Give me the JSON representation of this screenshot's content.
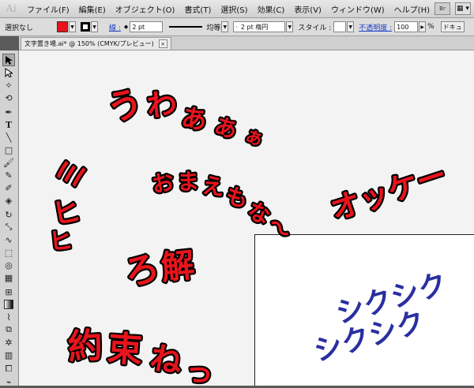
{
  "app": {
    "logo": "Ai"
  },
  "menu": [
    "ファイル(F)",
    "編集(E)",
    "オブジェクト(O)",
    "書式(T)",
    "選択(S)",
    "効果(C)",
    "表示(V)",
    "ウィンドウ(W)",
    "ヘルプ(H)"
  ],
  "menu_right": {
    "bridge": "Br",
    "arrange": "▦ ▾"
  },
  "control": {
    "selection": "選択なし",
    "fill_color": "#e8141c",
    "stroke_color": "#000000",
    "stroke_label": "線 :",
    "stroke_weight": "2 pt",
    "stroke_profile": "均等",
    "brush": "2 pt 楕円",
    "style_label": "スタイル :",
    "opacity_label": "不透明度 :",
    "opacity_value": "100",
    "opacity_unit": "%",
    "doc_setup": "ドキュ"
  },
  "document_tab": {
    "title": "文字置き場.ai* @ 150% (CMYK/プレビュー)",
    "close": "×"
  },
  "tools": [
    "selection-tool",
    "direct-selection-tool",
    "magic-wand-tool",
    "lasso-tool",
    "pen-tool",
    "type-tool",
    "line-tool",
    "rectangle-tool",
    "paintbrush-tool",
    "pencil-tool",
    "blob-brush-tool",
    "eraser-tool",
    "rotate-tool",
    "scale-tool",
    "warp-tool",
    "free-transform-tool",
    "shape-builder-tool",
    "perspective-tool",
    "mesh-tool",
    "gradient-tool",
    "eyedropper-tool",
    "blend-tool",
    "symbol-sprayer-tool",
    "graph-tool",
    "artboard-tool",
    "slice-tool",
    "hand-tool"
  ],
  "artwork": {
    "red_fill": "#e8141c",
    "blue_fill": "#2a2fa0",
    "texts": {
      "uwaaa": [
        "う",
        "わ",
        "あ",
        "あ",
        "ぁ"
      ],
      "omaemo": [
        "お",
        "ま",
        "え",
        "も",
        "な",
        "～"
      ],
      "okke": "オッケー",
      "mihi": [
        "ミ",
        "ヒ",
        "ヒ"
      ],
      "ryokai": [
        "ろ",
        "解"
      ],
      "yakusoku": [
        "約",
        "束",
        "ね",
        "っ"
      ],
      "shikushiku1": "シクシク",
      "shikushiku2": "シクシク"
    }
  }
}
